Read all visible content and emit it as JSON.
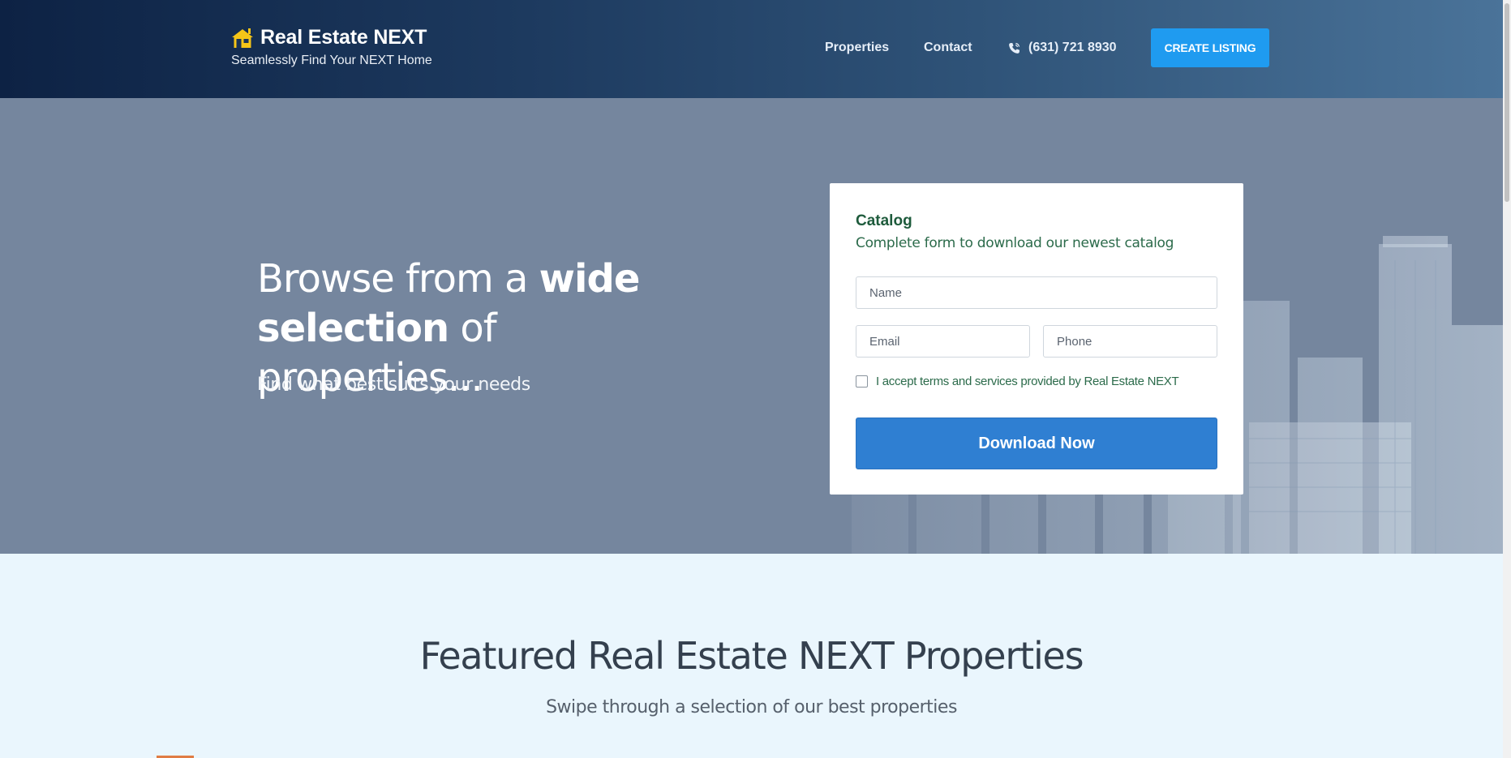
{
  "header": {
    "brand_title": "Real Estate NEXT",
    "brand_tagline": "Seamlessly Find Your NEXT Home",
    "brand_icon": "house-icon",
    "nav": {
      "properties": "Properties",
      "contact": "Contact",
      "phone": "(631) 721 8930",
      "phone_icon": "phone-icon"
    },
    "cta_label": "CREATE LISTING"
  },
  "hero": {
    "heading_part1": "Browse from a ",
    "heading_bold1": "wide",
    "heading_bold2": "selection",
    "heading_part2": " of properties...",
    "subheading": "Find what best suits your needs"
  },
  "catalog_form": {
    "title": "Catalog",
    "subtitle": "Complete form to download our newest catalog",
    "name_placeholder": "Name",
    "email_placeholder": "Email",
    "phone_placeholder": "Phone",
    "terms_label": "I accept terms and services provided by Real Estate NEXT",
    "terms_checked": false,
    "submit_label": "Download Now"
  },
  "featured": {
    "title": "Featured Real Estate NEXT Properties",
    "subtitle": "Swipe through a selection of our best properties"
  },
  "colors": {
    "header_gradient_start": "#0d2244",
    "header_gradient_end": "#4a7399",
    "cta": "#1f9bf0",
    "download_button": "#2f7fd2",
    "hero_overlay": "#75869e",
    "form_accent": "#1e5b3c",
    "brand_icon": "#f5c518",
    "featured_bg": "#eaf6fd"
  }
}
